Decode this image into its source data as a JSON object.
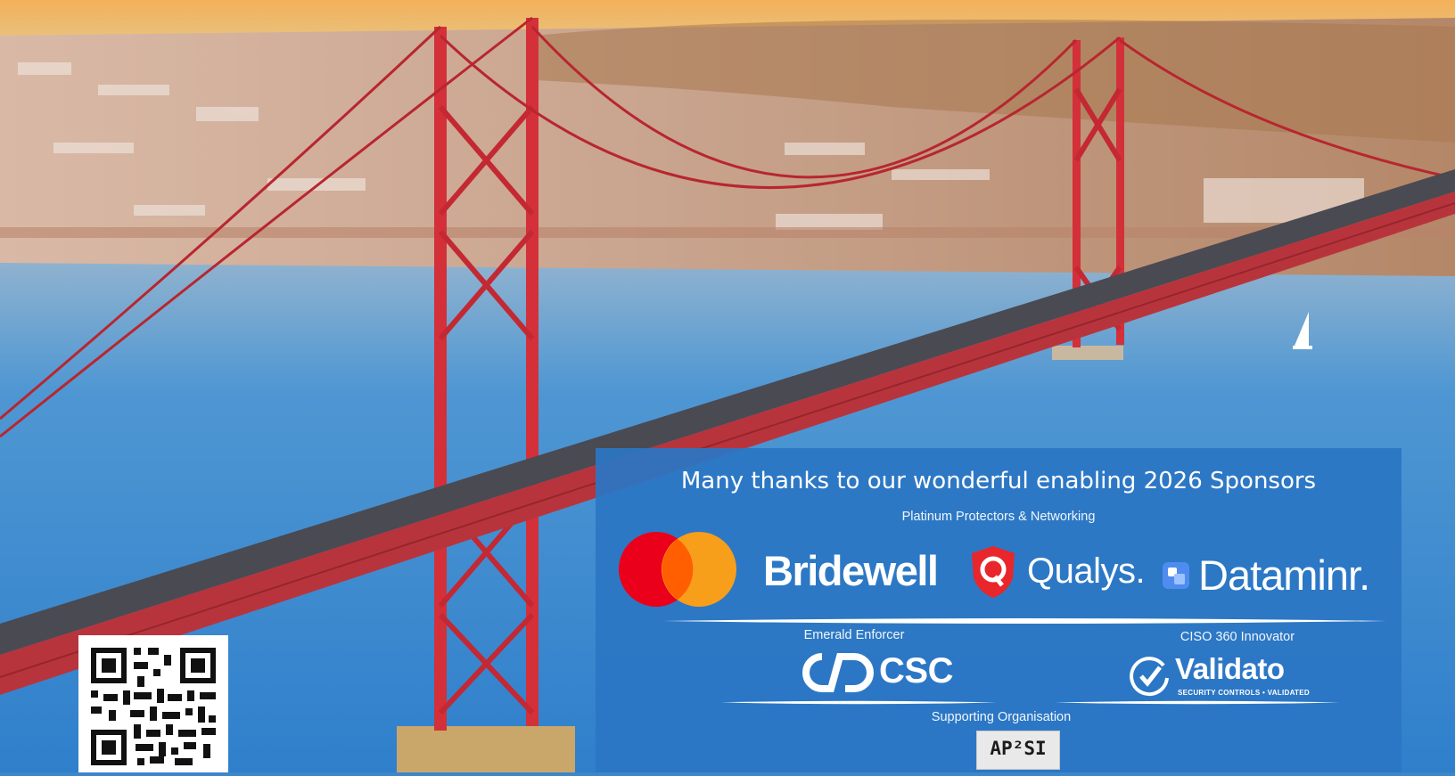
{
  "background": {
    "sky_top": "#f2a44e",
    "water": "#3d86c8",
    "bridge_red": "#d4303a"
  },
  "panel": {
    "title": "Many thanks to our wonderful enabling 2026 Sponsors",
    "background_color": "#2b76c4"
  },
  "tiers": {
    "platinum": "Platinum Protectors & Networking",
    "emerald": "Emerald Enforcer",
    "ciso": "CISO 360 Innovator",
    "supporting": "Supporting Organisation"
  },
  "sponsors": {
    "platinum": [
      {
        "name": "mastercard",
        "icon": "mastercard-logo-icon",
        "colors": [
          "#eb001b",
          "#f79e1b",
          "#ff5f00"
        ]
      },
      {
        "name": "Bridewell",
        "wordmark": "Bridewell"
      },
      {
        "name": "Qualys",
        "wordmark": "Qualys.",
        "icon": "qualys-shield-icon",
        "color": "#e8262b"
      },
      {
        "name": "Dataminr",
        "wordmark": "Dataminr.",
        "icon": "dataminr-square-icon"
      }
    ],
    "emerald": {
      "wordmark": "CSC",
      "icon": "csc-loop-icon"
    },
    "ciso": {
      "wordmark": "Validato",
      "tagline": "SECURITY CONTROLS • VALIDATED",
      "icon": "check-circle-icon"
    },
    "supporting": {
      "wordmark": "AP²SI",
      "icon": "ap2si-logo"
    }
  },
  "qr": {
    "icon": "qr-code-icon"
  }
}
